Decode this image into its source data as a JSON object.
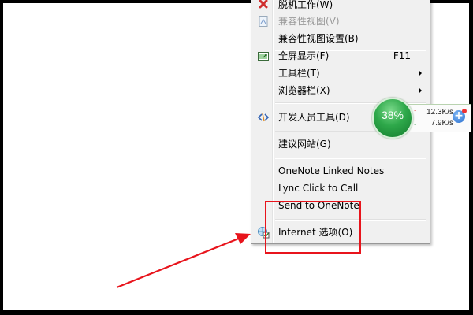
{
  "menu": {
    "items": [
      {
        "label": "脱机工作(W)",
        "disabled": false,
        "icon": "offline-icon"
      },
      {
        "label": "兼容性视图(V)",
        "disabled": true,
        "icon": "compat-view-icon"
      },
      {
        "label": "兼容性视图设置(B)",
        "disabled": false
      },
      {
        "label": "全屏显示(F)",
        "shortcut": "F11",
        "icon": "fullscreen-icon"
      },
      {
        "label": "工具栏(T)",
        "submenu": true
      },
      {
        "label": "浏览器栏(X)",
        "submenu": true
      },
      {
        "label": "开发人员工具(D)",
        "icon": "developer-tools-icon"
      },
      {
        "label": "建议网站(G)"
      },
      {
        "label": "OneNote Linked Notes"
      },
      {
        "label": "Lync Click to Call"
      },
      {
        "label": "Send to OneNote"
      },
      {
        "label": "Internet 选项(O)",
        "icon": "internet-options-icon"
      }
    ]
  },
  "speed_widget": {
    "percent": "38%",
    "upload": "12.3K/s",
    "download": "7.9K/s",
    "up_arrow": "↑",
    "down_arrow": "↓",
    "plus": "+"
  },
  "colors": {
    "highlight": "#e8141c",
    "menu_bg": "#f0f0f0",
    "disabled_text": "#9a9a9a",
    "widget_green": "#2ea84a"
  }
}
